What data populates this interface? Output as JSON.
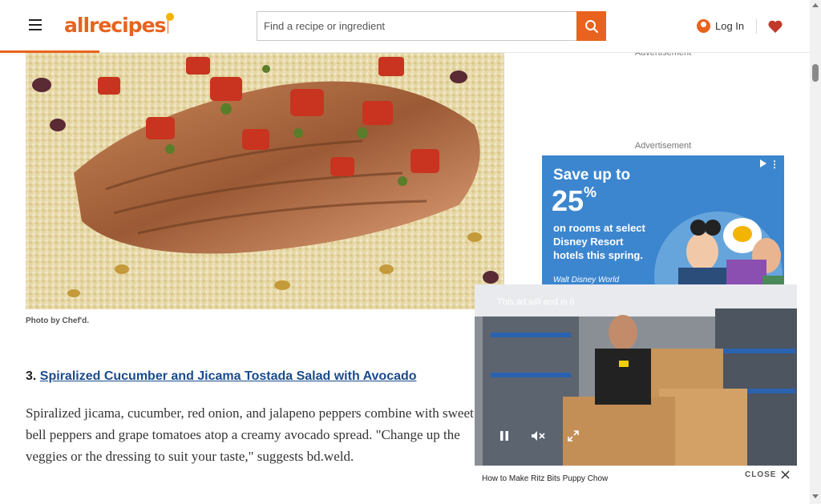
{
  "header": {
    "logo_text": "allrecipes",
    "search_placeholder": "Find a recipe or ingredient",
    "login_label": "Log In",
    "accent_color": "#e8631e"
  },
  "content": {
    "photo_caption": "Photo by Chef'd.",
    "recipe_number": "3.",
    "recipe_link": "Spiralized Cucumber and Jicama Tostada Salad with Avocado",
    "description": "Spiralized jicama, cucumber, red onion, and jalapeno peppers combine with sweet bell peppers and grape tomatoes atop a creamy avocado spread. \"Change up the veggies or the dressing to suit your taste,\" suggests bd.weld."
  },
  "ads": {
    "label_top": "Advertisement",
    "label_mid": "Advertisement",
    "headline": "Save up to",
    "percent": "25",
    "percent_sign": "%",
    "body": "on rooms at select Disney Resort hotels this spring.",
    "brand": "Walt Disney World"
  },
  "video": {
    "countdown": "This ad will end in 8",
    "title": "How to Make Ritz Bits Puppy Chow",
    "close_label": "CLOSE"
  },
  "icons": [
    "menu-icon",
    "search-icon",
    "user-icon",
    "heart-icon",
    "pause-icon",
    "mute-icon",
    "fullscreen-icon",
    "close-icon",
    "adchoices-icon"
  ]
}
